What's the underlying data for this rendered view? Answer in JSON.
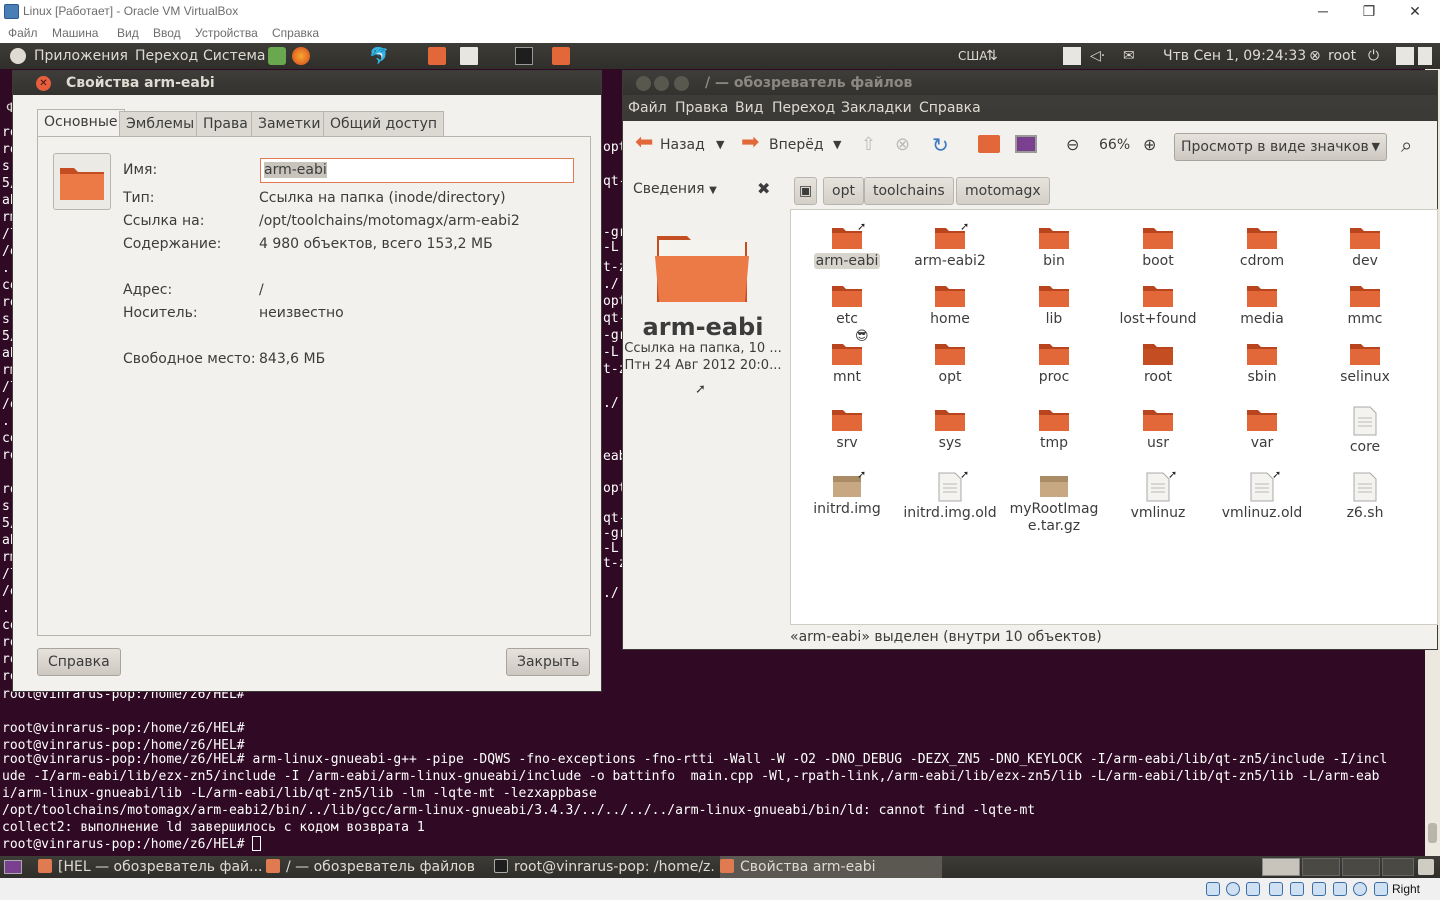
{
  "vbox": {
    "title": "Linux [Работает] - Oracle VM VirtualBox",
    "menu": [
      "Файл",
      "Машина",
      "Вид",
      "Ввод",
      "Устройства",
      "Справка"
    ],
    "host_key": "Right Ctrl"
  },
  "panel": {
    "apps": "Приложения",
    "places": "Переход",
    "system": "Система",
    "keyboard_layout": "США",
    "datetime": "Чтв Сен  1, 09:24:33",
    "user": "root"
  },
  "terminal": {
    "menu_fragment": "Фа",
    "side_fragments": [
      "root",
      "roo",
      "s -",
      "5/i",
      "abi",
      "rm-",
      "/li",
      "/op",
      "../",
      "col",
      "roo",
      "s -",
      "5/i",
      "abi",
      "rm-",
      "/li",
      "/op",
      "../",
      "col",
      "roo",
      " -t",
      "roo",
      "s -",
      "5/i",
      "abi",
      "rm-",
      "/li",
      "/op",
      "../",
      "col",
      "roo",
      "roo",
      "roo"
    ],
    "mid_fragments": [
      "opti",
      "qt-",
      "-gr",
      "-L",
      "t-z",
      "./",
      "opti",
      "qt-",
      "-gr",
      "-L",
      "t-z",
      "./",
      "eab",
      "opti",
      "qt-",
      "-gr",
      "-L",
      "t-z",
      "./"
    ],
    "lines": [
      "root@vinrarus-pop:/home/z6/HEL#",
      "root@vinrarus-pop:/home/z6/HEL#",
      "root@vinrarus-pop:/home/z6/HEL#",
      "root@vinrarus-pop:/home/z6/HEL# arm-linux-gnueabi-g++ -pipe -DQWS -fno-exceptions -fno-rtti -Wall -W -O2 -DNO_DEBUG -DEZX_ZN5 -DNO_KEYLOCK -I/arm-eabi/lib/qt-zn5/include -I/incl",
      "ude -I/arm-eabi/lib/ezx-zn5/include -I /arm-eabi/arm-linux-gnueabi/include -o battinfo  main.cpp -Wl,-rpath-link,/arm-eabi/lib/ezx-zn5/lib -L/arm-eabi/lib/qt-zn5/lib -L/arm-eab",
      "i/arm-linux-gnueabi/lib -L/arm-eabi/lib/qt-zn5/lib -lm -lqte-mt -lezxappbase",
      "/opt/toolchains/motomagx/arm-eabi2/bin/../lib/gcc/arm-linux-gnueabi/3.4.3/../../../../arm-linux-gnueabi/bin/ld: cannot find -lqte-mt",
      "collect2: выполнение ld завершилось с кодом возврата 1",
      "root@vinrarus-pop:/home/z6/HEL# "
    ]
  },
  "props": {
    "title": "Свойства arm-eabi",
    "tabs": [
      "Основные",
      "Эмблемы",
      "Права",
      "Заметки",
      "Общий доступ"
    ],
    "name_label": "Имя:",
    "name_value": "arm-eabi",
    "rows": [
      {
        "label": "Тип:",
        "value": "Ссылка на папка (inode/directory)"
      },
      {
        "label": "Ссылка на:",
        "value": "/opt/toolchains/motomagx/arm-eabi2"
      },
      {
        "label": "Содержание:",
        "value": "4 980 объектов, всего 153,2 МБ"
      },
      {
        "label": "Адрес:",
        "value": "/"
      },
      {
        "label": "Носитель:",
        "value": "неизвестно"
      },
      {
        "label": "Свободное место:",
        "value": "843,6 МБ"
      }
    ],
    "help_button": "Справка",
    "close_button": "Закрыть"
  },
  "filebrowser": {
    "title": "/ — обозреватель файлов",
    "menu": [
      "Файл",
      "Правка",
      "Вид",
      "Переход",
      "Закладки",
      "Справка"
    ],
    "back": "Назад",
    "forward": "Вперёд",
    "zoom": "66%",
    "view_mode": "Просмотр в виде значков",
    "sidebar_title": "Сведения",
    "selected_name": "arm-eabi",
    "selected_info1": "Ссылка на папка, 10 ...",
    "selected_info2": "Птн 24 Авг 2012 20:0...",
    "breadcrumbs": [
      "opt",
      "toolchains",
      "motomagx"
    ],
    "items": [
      {
        "name": "arm-eabi",
        "kind": "folder-link"
      },
      {
        "name": "arm-eabi2",
        "kind": "folder-link"
      },
      {
        "name": "bin",
        "kind": "folder"
      },
      {
        "name": "boot",
        "kind": "folder"
      },
      {
        "name": "cdrom",
        "kind": "folder"
      },
      {
        "name": "dev",
        "kind": "folder"
      },
      {
        "name": "etc",
        "kind": "folder"
      },
      {
        "name": "home",
        "kind": "folder"
      },
      {
        "name": "lib",
        "kind": "folder"
      },
      {
        "name": "lost+found",
        "kind": "folder"
      },
      {
        "name": "media",
        "kind": "folder"
      },
      {
        "name": "mmc",
        "kind": "folder"
      },
      {
        "name": "mnt",
        "kind": "folder-emblem"
      },
      {
        "name": "opt",
        "kind": "folder"
      },
      {
        "name": "proc",
        "kind": "folder"
      },
      {
        "name": "root",
        "kind": "folder-home"
      },
      {
        "name": "sbin",
        "kind": "folder"
      },
      {
        "name": "selinux",
        "kind": "folder"
      },
      {
        "name": "srv",
        "kind": "folder"
      },
      {
        "name": "sys",
        "kind": "folder"
      },
      {
        "name": "tmp",
        "kind": "folder"
      },
      {
        "name": "usr",
        "kind": "folder"
      },
      {
        "name": "var",
        "kind": "folder"
      },
      {
        "name": "core",
        "kind": "file"
      },
      {
        "name": "initrd.img",
        "kind": "archive-link"
      },
      {
        "name": "initrd.img.old",
        "kind": "file-link"
      },
      {
        "name": "myRootImag e.tar.gz",
        "kind": "archive"
      },
      {
        "name": "vmlinuz",
        "kind": "binary-link"
      },
      {
        "name": "vmlinuz.old",
        "kind": "file-link"
      },
      {
        "name": "z6.sh",
        "kind": "script"
      }
    ],
    "status": "«arm-eabi» выделен (внутри 10 объектов)"
  },
  "taskbar": {
    "tasks": [
      "[HEL — обозреватель фай...",
      "/ — обозреватель файлов",
      "root@vinrarus-pop: /home/z...",
      "Свойства arm-eabi"
    ]
  },
  "colors": {
    "folder": "#e2683a",
    "terminal_bg": "#300a24",
    "panel": "#3c3b37"
  }
}
